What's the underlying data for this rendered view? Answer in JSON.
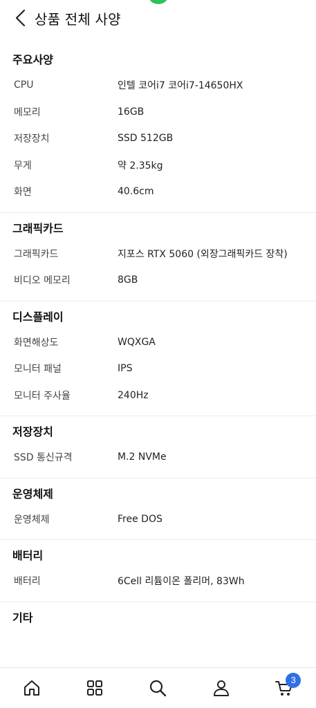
{
  "header": {
    "title": "상품 전체 사양"
  },
  "sections": [
    {
      "title": "주요사양",
      "rows": [
        {
          "label": "CPU",
          "value": "인텔 코어i7 코어i7-14650HX"
        },
        {
          "label": "메모리",
          "value": "16GB"
        },
        {
          "label": "저장장치",
          "value": "SSD 512GB"
        },
        {
          "label": "무게",
          "value": "약 2.35kg"
        },
        {
          "label": "화면",
          "value": "40.6cm"
        }
      ]
    },
    {
      "title": "그래픽카드",
      "rows": [
        {
          "label": "그래픽카드",
          "value": "지포스 RTX 5060 (외장그래픽카드 장착)"
        },
        {
          "label": "비디오 메모리",
          "value": "8GB"
        }
      ]
    },
    {
      "title": "디스플레이",
      "rows": [
        {
          "label": "화면해상도",
          "value": "WQXGA"
        },
        {
          "label": "모니터 패널",
          "value": "IPS"
        },
        {
          "label": "모니터 주사율",
          "value": "240Hz"
        }
      ]
    },
    {
      "title": "저장장치",
      "rows": [
        {
          "label": "SSD 통신규격",
          "value": "M.2 NVMe"
        }
      ]
    },
    {
      "title": "운영체제",
      "rows": [
        {
          "label": "운영체제",
          "value": "Free DOS"
        }
      ]
    },
    {
      "title": "배터리",
      "rows": [
        {
          "label": "배터리",
          "value": "6Cell 리튬이온 폴리머, 83Wh"
        }
      ]
    },
    {
      "title": "기타",
      "rows": []
    }
  ],
  "bottom_nav": {
    "items": [
      {
        "icon": "home-icon"
      },
      {
        "icon": "grid-icon"
      },
      {
        "icon": "search-icon"
      },
      {
        "icon": "user-icon"
      },
      {
        "icon": "cart-icon"
      }
    ],
    "cart_count": "3"
  },
  "colors": {
    "accent_green": "#2fc25a",
    "badge_blue": "#2f6fe6"
  }
}
